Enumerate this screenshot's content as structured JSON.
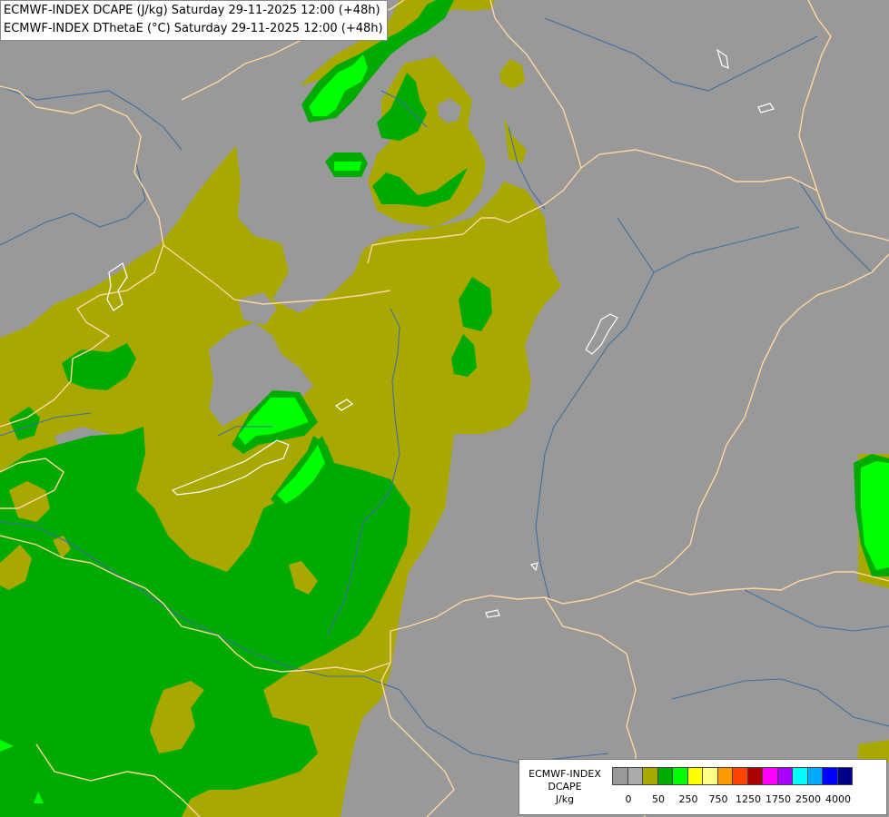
{
  "header": {
    "line1": "ECMWF-INDEX DCAPE (J/kg) Saturday 29-11-2025 12:00 (+48h)",
    "line2": "ECMWF-INDEX DThetaE (°C) Saturday 29-11-2025 12:00 (+48h)"
  },
  "legend": {
    "model": "ECMWF-INDEX",
    "parameter": "DCAPE",
    "unit": "J/kg",
    "colors": [
      "#999999",
      "#aaaaaa",
      "#a8a800",
      "#00aa00",
      "#00ff00",
      "#ffff00",
      "#ffff88",
      "#ff9900",
      "#ff4400",
      "#aa0000",
      "#ff00ff",
      "#aa00ff",
      "#00ffff",
      "#00aaff",
      "#0000ff",
      "#000088"
    ],
    "tick_labels": [
      "0",
      "50",
      "250",
      "750",
      "1250",
      "1750",
      "2500",
      "4000"
    ]
  },
  "colors": {
    "background": "#999999",
    "dcape_low": "#a8a800",
    "dcape_mid": "#00aa00",
    "dcape_high": "#00ff00",
    "borders": "#ffd6a0",
    "rivers": "#3f6fa0",
    "lakes": "#ffffff"
  }
}
